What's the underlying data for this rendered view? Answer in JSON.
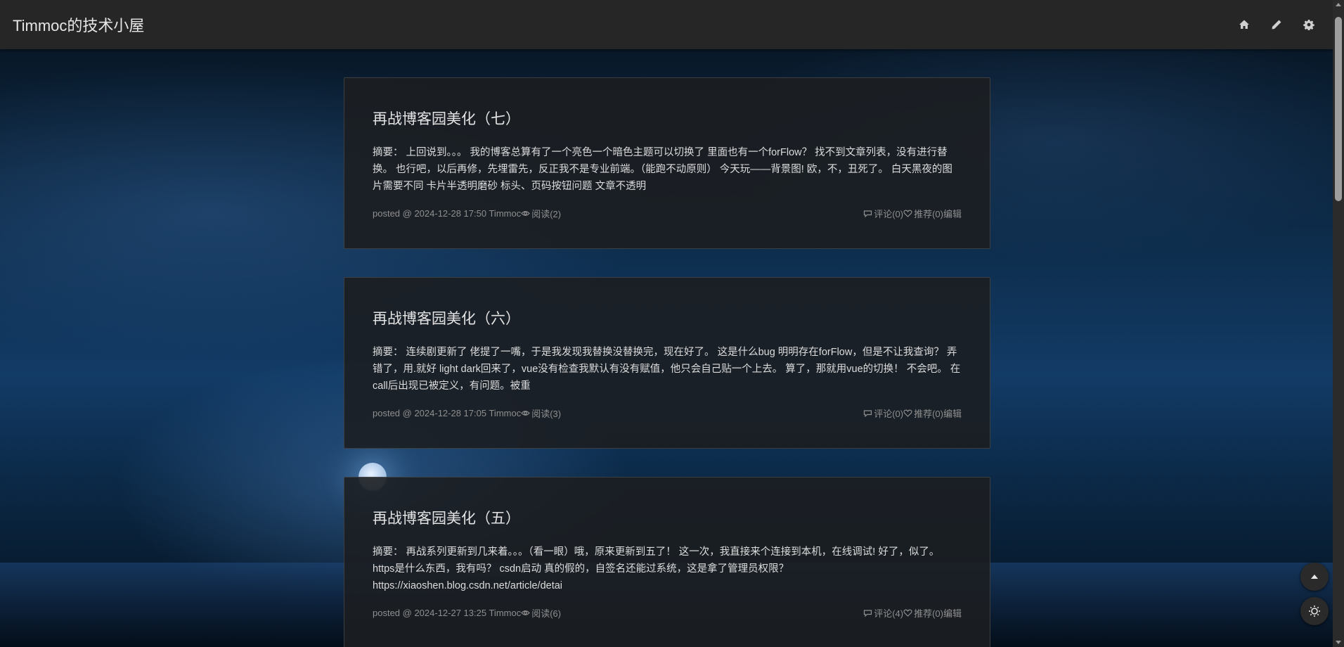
{
  "header": {
    "site_title": "Timmoc的技术小屋",
    "icons": [
      "home-icon",
      "edit-icon",
      "settings-icon"
    ]
  },
  "posts": [
    {
      "title": "再战博客园美化（七）",
      "summary": "摘要： 上回说到。。。 我的博客总算有了一个亮色一个暗色主题可以切换了 里面也有一个forFlow？ 找不到文章列表，没有进行替换。 也行吧，以后再修，先埋雷先，反正我不是专业前端。（能跑不动原则） 今天玩——背景图! 欧，不，丑死了。 白天黑夜的图片需要不同 卡片半透明磨砂 标头、页码按钮问题 文章不透明",
      "meta_posted": "posted @ 2024-12-28 17:50 Timmoc",
      "views": " 阅读(2)",
      "comments": " 评论(0)",
      "recommend": " 推荐(0)",
      "edit": "编辑"
    },
    {
      "title": "再战博客园美化（六）",
      "summary": "摘要： 连续剧更新了 佬提了一嘴，于是我发现我替换没替换完，现在好了。 这是什么bug 明明存在forFlow，但是不让我查询？ 弄错了，用.就好 light dark回来了，vue没有检查我默认有没有赋值，他只会自己贴一个上去。 算了，那就用vue的切换！ 不会吧。 在call后出现已被定义，有问题。被重",
      "meta_posted": "posted @ 2024-12-28 17:05 Timmoc",
      "views": " 阅读(3)",
      "comments": " 评论(0)",
      "recommend": " 推荐(0)",
      "edit": "编辑"
    },
    {
      "title": "再战博客园美化（五）",
      "summary": "摘要： 再战系列更新到几来着。。。（看一眼）哦，原来更新到五了！ 这一次，我直接来个连接到本机，在线调试! 好了，似了。 https是什么东西，我有吗？ csdn启动 真的假的，自签名还能过系统，这是拿了管理员权限？ https://xiaoshen.blog.csdn.net/article/detai",
      "meta_posted": "posted @ 2024-12-27 13:25 Timmoc",
      "views": " 阅读(6)",
      "comments": " 评论(4)",
      "recommend": " 推荐(0)",
      "edit": "编辑"
    }
  ],
  "floating": {
    "icons": [
      "back-to-top-icon",
      "theme-toggle-icon"
    ]
  },
  "colors": {
    "header_bg": "#262626",
    "card_bg": "#1c1e21",
    "text": "#dcdcdc",
    "meta": "#8f8f8f"
  }
}
